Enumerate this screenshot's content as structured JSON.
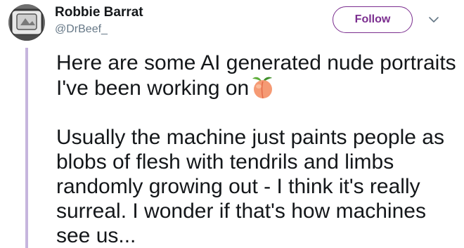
{
  "user": {
    "name": "Robbie Barrat",
    "handle": "@DrBeef_"
  },
  "actions": {
    "follow_label": "Follow",
    "menu_icon": "chevron-down-icon"
  },
  "tweet": {
    "paragraph1": "Here are some AI generated nude portraits I've been working on",
    "paragraph1_emoji": "peach-emoji",
    "paragraph2": "Usually the machine just paints people as blobs of flesh with tendrils and limbs randomly growing out - I think it's really surreal. I wonder if that's how machines see us..."
  },
  "colors": {
    "accent": "#7b2e8f",
    "thread_line": "#c6b5dd",
    "text": "#14171a",
    "secondary_text": "#657786"
  }
}
